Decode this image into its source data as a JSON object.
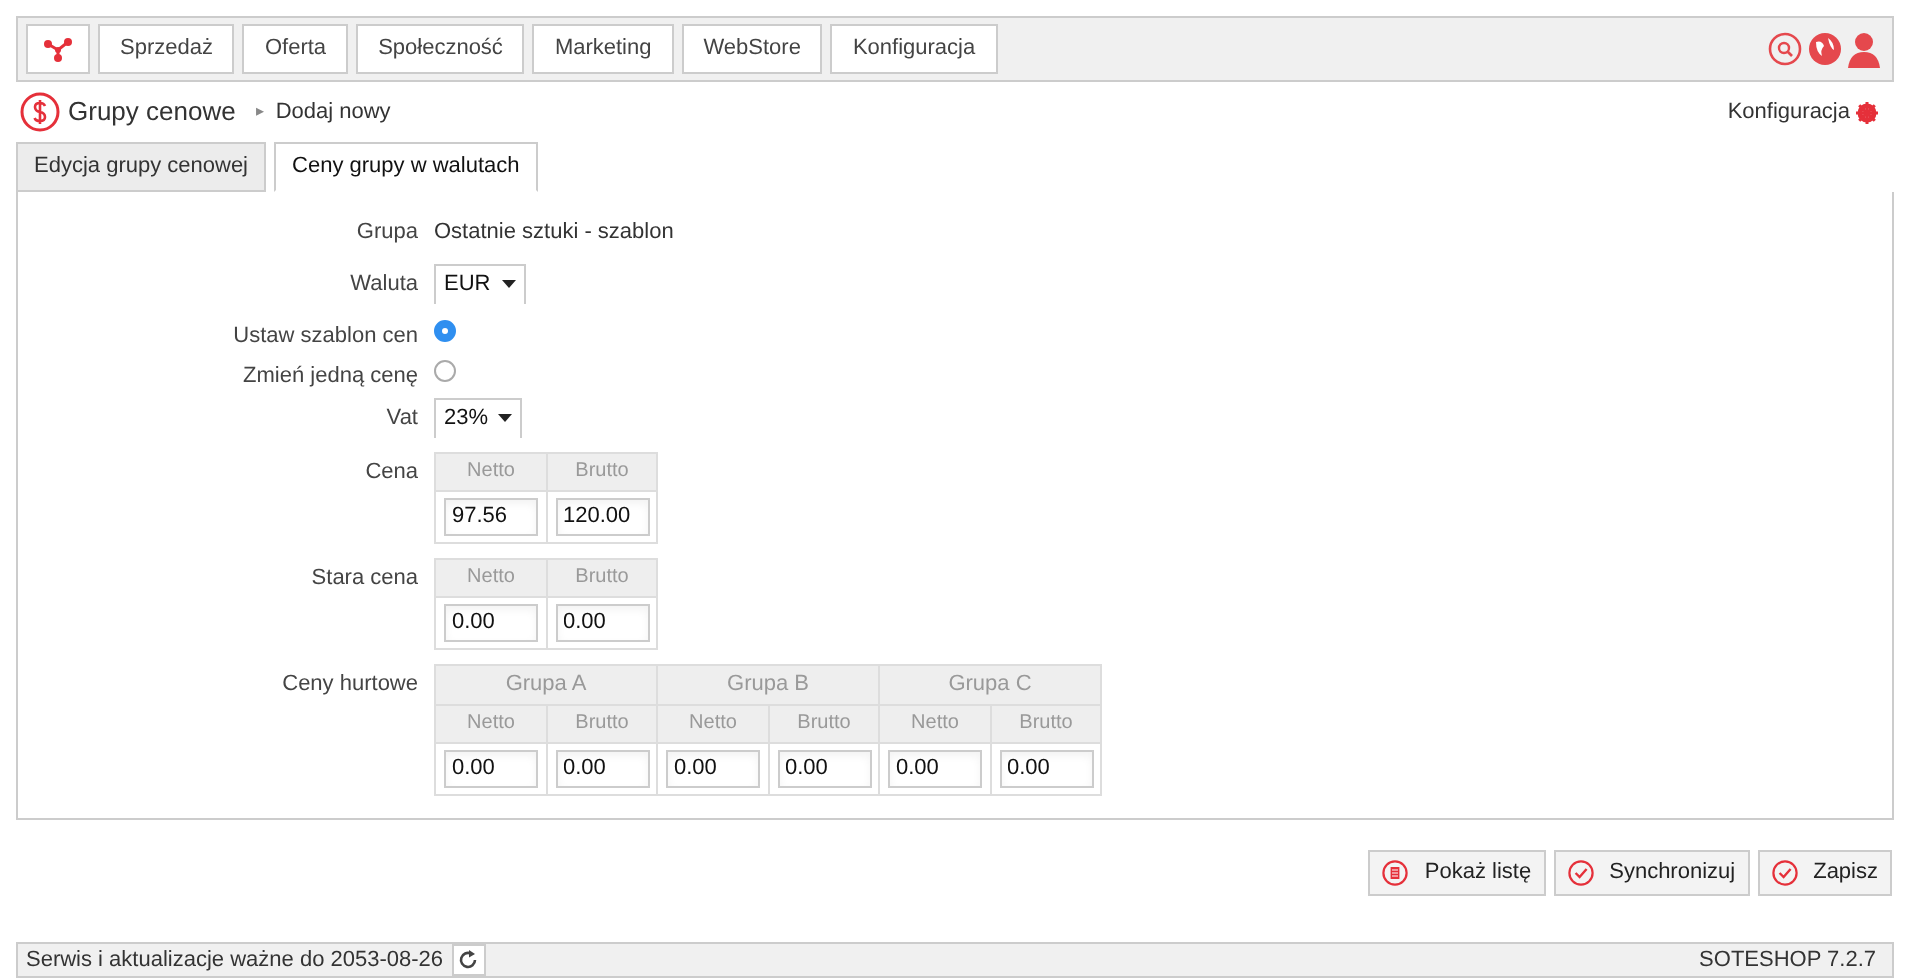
{
  "nav": {
    "items": [
      {
        "label": "Sprzedaż"
      },
      {
        "label": "Oferta"
      },
      {
        "label": "Społeczność"
      },
      {
        "label": "Marketing"
      },
      {
        "label": "WebStore"
      },
      {
        "label": "Konfiguracja"
      }
    ]
  },
  "breadcrumb": {
    "title": "Grupy cenowe",
    "separator": "▸",
    "current": "Dodaj nowy"
  },
  "settings_link": "Konfiguracja",
  "tabs": [
    {
      "label": "Edycja grupy cenowej",
      "selected": false
    },
    {
      "label": "Ceny grupy w walutach",
      "selected": true
    }
  ],
  "form": {
    "group_label": "Grupa",
    "group_value": "Ostatnie sztuki - szablon",
    "currency": {
      "label": "Waluta",
      "value": "EUR"
    },
    "radios": [
      {
        "label": "Ustaw szablon cen",
        "checked": true
      },
      {
        "label": "Zmień jedną cenę",
        "checked": false
      }
    ],
    "vat": {
      "label": "Vat",
      "value": "23%"
    },
    "price": {
      "label": "Cena",
      "columns": [
        "Netto",
        "Brutto"
      ],
      "values": [
        "97.56",
        "120.00"
      ]
    },
    "old_price": {
      "label": "Stara cena",
      "columns": [
        "Netto",
        "Brutto"
      ],
      "values": [
        "0.00",
        "0.00"
      ]
    },
    "wholesale": {
      "label": "Ceny hurtowe",
      "groups": [
        {
          "name": "Grupa A",
          "columns": [
            "Netto",
            "Brutto"
          ],
          "values": [
            "0.00",
            "0.00"
          ]
        },
        {
          "name": "Grupa B",
          "columns": [
            "Netto",
            "Brutto"
          ],
          "values": [
            "0.00",
            "0.00"
          ]
        },
        {
          "name": "Grupa C",
          "columns": [
            "Netto",
            "Brutto"
          ],
          "values": [
            "0.00",
            "0.00"
          ]
        }
      ]
    }
  },
  "actions": [
    {
      "label": "Pokaż listę",
      "kind": "list"
    },
    {
      "label": "Synchronizuj",
      "kind": "check"
    },
    {
      "label": "Zapisz",
      "kind": "check"
    }
  ],
  "status_bar": {
    "left": "Serwis i aktualizacje ważne do 2053-08-26",
    "right": "SOTESHOP 7.2.7"
  }
}
